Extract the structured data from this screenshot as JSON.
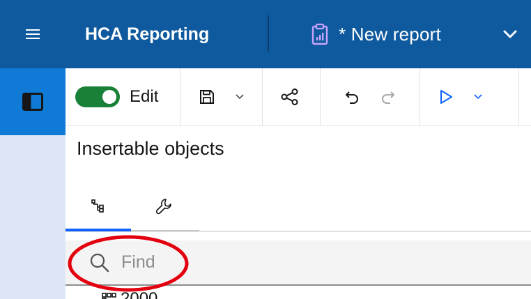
{
  "header": {
    "app_title": "HCA Reporting",
    "report_title": "* New report",
    "menu_icon": "hamburger-menu-icon",
    "report_icon": "clipboard-report-icon",
    "chevron_icon": "chevron-down-icon",
    "background_color": "#0f5a9e"
  },
  "rail": {
    "toggle_icon": "panel-toggle-icon",
    "active_color": "#0f7bd6"
  },
  "toolbar": {
    "edit_label": "Edit",
    "edit_enabled": true,
    "toggle_color": "#198038",
    "items": [
      {
        "name": "save",
        "icon": "save-icon"
      },
      {
        "name": "save-options",
        "icon": "chevron-down-icon"
      },
      {
        "name": "share",
        "icon": "share-icon"
      },
      {
        "name": "undo",
        "icon": "undo-icon"
      },
      {
        "name": "redo",
        "icon": "redo-icon"
      },
      {
        "name": "run",
        "icon": "play-icon"
      },
      {
        "name": "run-options",
        "icon": "chevron-down-icon"
      }
    ]
  },
  "panel": {
    "title": "Insertable objects",
    "tabs": [
      {
        "name": "source",
        "icon": "data-tree-icon",
        "active": true
      },
      {
        "name": "toolbox",
        "icon": "wrench-icon",
        "active": false
      }
    ],
    "search": {
      "placeholder": "Find",
      "value": ""
    },
    "tree_items": [
      {
        "label": "2000",
        "icon": "hierarchy-icon"
      }
    ]
  },
  "annotation": {
    "type": "ellipse",
    "color": "#e3000f",
    "target": "search"
  }
}
